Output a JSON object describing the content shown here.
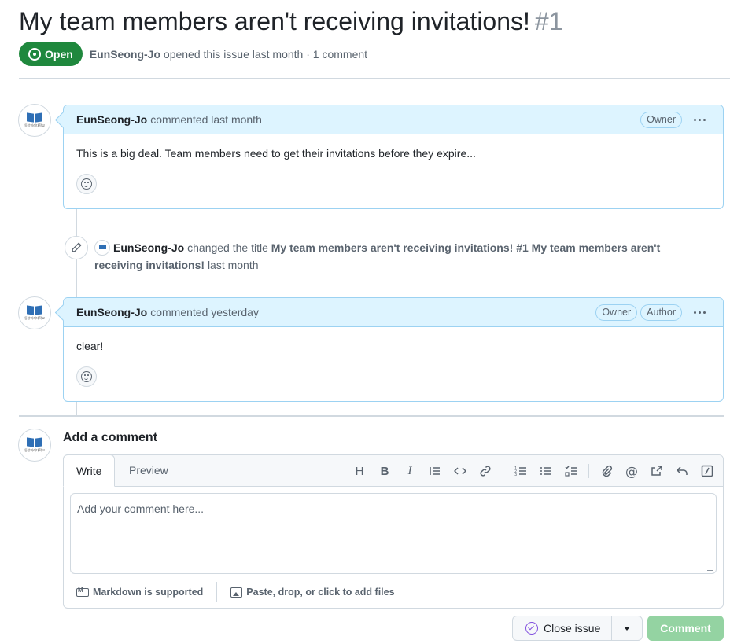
{
  "issue": {
    "title": "My team members aren't receiving invitations!",
    "number": "#1",
    "state": "Open",
    "author": "EunSeong-Jo",
    "meta_suffix": "opened this issue last month · 1 comment"
  },
  "comments": [
    {
      "author": "EunSeong-Jo",
      "action": "commented last month",
      "labels": [
        "Owner"
      ],
      "body": "This is a big deal. Team members need to get their invitations before they expire..."
    },
    {
      "author": "EunSeong-Jo",
      "action": "commented yesterday",
      "labels": [
        "Owner",
        "Author"
      ],
      "body": "clear!"
    }
  ],
  "event": {
    "actor": "EunSeong-Jo",
    "verb": "changed the title",
    "old_title": "My team members aren't receiving invitations! #1",
    "new_title": "My team members aren't receiving invitations!",
    "time": "last month"
  },
  "composer": {
    "heading": "Add a comment",
    "tab_write": "Write",
    "tab_preview": "Preview",
    "placeholder": "Add your comment here...",
    "markdown_note": "Markdown is supported",
    "files_note": "Paste, drop, or click to add files"
  },
  "actions": {
    "close_issue": "Close issue",
    "comment": "Comment"
  },
  "colors": {
    "open_badge": "#1f883d",
    "comment_border": "#9cd2f2",
    "comment_header_bg": "#ddf4ff",
    "comment_button_disabled": "#94d3a2",
    "close_icon": "#8250df"
  }
}
